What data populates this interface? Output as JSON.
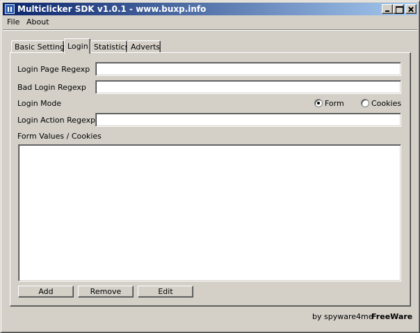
{
  "window": {
    "title": "Multiclicker SDK v1.0.1 - www.buxp.info",
    "icon": "app-icon",
    "controls": [
      "minimize-icon",
      "maximize-icon",
      "close-icon"
    ]
  },
  "menu": {
    "items": [
      {
        "label": "File"
      },
      {
        "label": "About"
      }
    ]
  },
  "tabs": [
    {
      "label": "Basic Settings",
      "active": false
    },
    {
      "label": "Login",
      "active": true
    },
    {
      "label": "Statistics",
      "active": false
    },
    {
      "label": "Adverts",
      "active": false
    }
  ],
  "login": {
    "login_page_regexp": {
      "label": "Login Page Regexp",
      "value": ""
    },
    "bad_login_regexp": {
      "label": "Bad Login Regexp",
      "value": ""
    },
    "login_mode": {
      "label": "Login Mode",
      "options": [
        {
          "label": "Form",
          "checked": true
        },
        {
          "label": "Cookies",
          "checked": false
        }
      ]
    },
    "login_action_regexp": {
      "label": "Login Action Regexp",
      "value": ""
    },
    "form_values": {
      "label": "Form Values / Cookies",
      "items": []
    },
    "buttons": {
      "add": "Add",
      "remove": "Remove",
      "edit": "Edit"
    }
  },
  "footer": {
    "credit": "by spyware4me",
    "license": "FreeWare"
  }
}
